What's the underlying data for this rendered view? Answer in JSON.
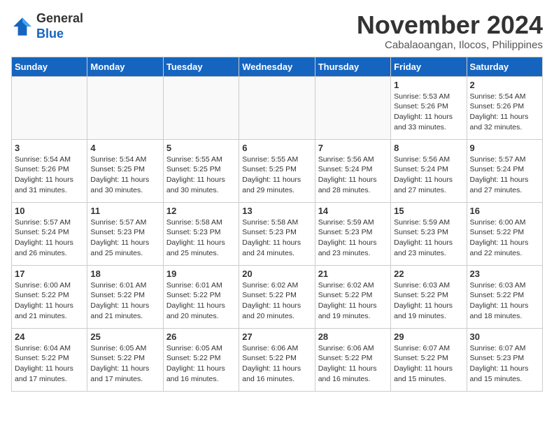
{
  "header": {
    "logo_line1": "General",
    "logo_line2": "Blue",
    "month_title": "November 2024",
    "location": "Cabalaoangan, Ilocos, Philippines"
  },
  "weekdays": [
    "Sunday",
    "Monday",
    "Tuesday",
    "Wednesday",
    "Thursday",
    "Friday",
    "Saturday"
  ],
  "weeks": [
    [
      {
        "day": "",
        "info": ""
      },
      {
        "day": "",
        "info": ""
      },
      {
        "day": "",
        "info": ""
      },
      {
        "day": "",
        "info": ""
      },
      {
        "day": "",
        "info": ""
      },
      {
        "day": "1",
        "info": "Sunrise: 5:53 AM\nSunset: 5:26 PM\nDaylight: 11 hours\nand 33 minutes."
      },
      {
        "day": "2",
        "info": "Sunrise: 5:54 AM\nSunset: 5:26 PM\nDaylight: 11 hours\nand 32 minutes."
      }
    ],
    [
      {
        "day": "3",
        "info": "Sunrise: 5:54 AM\nSunset: 5:26 PM\nDaylight: 11 hours\nand 31 minutes."
      },
      {
        "day": "4",
        "info": "Sunrise: 5:54 AM\nSunset: 5:25 PM\nDaylight: 11 hours\nand 30 minutes."
      },
      {
        "day": "5",
        "info": "Sunrise: 5:55 AM\nSunset: 5:25 PM\nDaylight: 11 hours\nand 30 minutes."
      },
      {
        "day": "6",
        "info": "Sunrise: 5:55 AM\nSunset: 5:25 PM\nDaylight: 11 hours\nand 29 minutes."
      },
      {
        "day": "7",
        "info": "Sunrise: 5:56 AM\nSunset: 5:24 PM\nDaylight: 11 hours\nand 28 minutes."
      },
      {
        "day": "8",
        "info": "Sunrise: 5:56 AM\nSunset: 5:24 PM\nDaylight: 11 hours\nand 27 minutes."
      },
      {
        "day": "9",
        "info": "Sunrise: 5:57 AM\nSunset: 5:24 PM\nDaylight: 11 hours\nand 27 minutes."
      }
    ],
    [
      {
        "day": "10",
        "info": "Sunrise: 5:57 AM\nSunset: 5:24 PM\nDaylight: 11 hours\nand 26 minutes."
      },
      {
        "day": "11",
        "info": "Sunrise: 5:57 AM\nSunset: 5:23 PM\nDaylight: 11 hours\nand 25 minutes."
      },
      {
        "day": "12",
        "info": "Sunrise: 5:58 AM\nSunset: 5:23 PM\nDaylight: 11 hours\nand 25 minutes."
      },
      {
        "day": "13",
        "info": "Sunrise: 5:58 AM\nSunset: 5:23 PM\nDaylight: 11 hours\nand 24 minutes."
      },
      {
        "day": "14",
        "info": "Sunrise: 5:59 AM\nSunset: 5:23 PM\nDaylight: 11 hours\nand 23 minutes."
      },
      {
        "day": "15",
        "info": "Sunrise: 5:59 AM\nSunset: 5:23 PM\nDaylight: 11 hours\nand 23 minutes."
      },
      {
        "day": "16",
        "info": "Sunrise: 6:00 AM\nSunset: 5:22 PM\nDaylight: 11 hours\nand 22 minutes."
      }
    ],
    [
      {
        "day": "17",
        "info": "Sunrise: 6:00 AM\nSunset: 5:22 PM\nDaylight: 11 hours\nand 21 minutes."
      },
      {
        "day": "18",
        "info": "Sunrise: 6:01 AM\nSunset: 5:22 PM\nDaylight: 11 hours\nand 21 minutes."
      },
      {
        "day": "19",
        "info": "Sunrise: 6:01 AM\nSunset: 5:22 PM\nDaylight: 11 hours\nand 20 minutes."
      },
      {
        "day": "20",
        "info": "Sunrise: 6:02 AM\nSunset: 5:22 PM\nDaylight: 11 hours\nand 20 minutes."
      },
      {
        "day": "21",
        "info": "Sunrise: 6:02 AM\nSunset: 5:22 PM\nDaylight: 11 hours\nand 19 minutes."
      },
      {
        "day": "22",
        "info": "Sunrise: 6:03 AM\nSunset: 5:22 PM\nDaylight: 11 hours\nand 19 minutes."
      },
      {
        "day": "23",
        "info": "Sunrise: 6:03 AM\nSunset: 5:22 PM\nDaylight: 11 hours\nand 18 minutes."
      }
    ],
    [
      {
        "day": "24",
        "info": "Sunrise: 6:04 AM\nSunset: 5:22 PM\nDaylight: 11 hours\nand 17 minutes."
      },
      {
        "day": "25",
        "info": "Sunrise: 6:05 AM\nSunset: 5:22 PM\nDaylight: 11 hours\nand 17 minutes."
      },
      {
        "day": "26",
        "info": "Sunrise: 6:05 AM\nSunset: 5:22 PM\nDaylight: 11 hours\nand 16 minutes."
      },
      {
        "day": "27",
        "info": "Sunrise: 6:06 AM\nSunset: 5:22 PM\nDaylight: 11 hours\nand 16 minutes."
      },
      {
        "day": "28",
        "info": "Sunrise: 6:06 AM\nSunset: 5:22 PM\nDaylight: 11 hours\nand 16 minutes."
      },
      {
        "day": "29",
        "info": "Sunrise: 6:07 AM\nSunset: 5:22 PM\nDaylight: 11 hours\nand 15 minutes."
      },
      {
        "day": "30",
        "info": "Sunrise: 6:07 AM\nSunset: 5:23 PM\nDaylight: 11 hours\nand 15 minutes."
      }
    ]
  ]
}
